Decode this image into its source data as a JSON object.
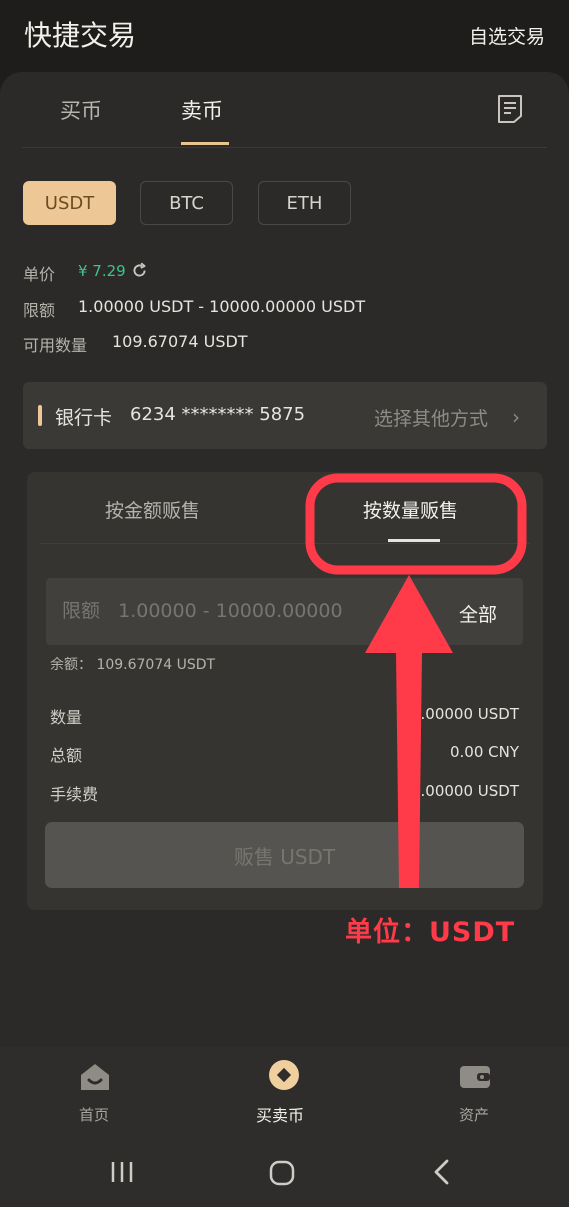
{
  "header": {
    "title": "快捷交易",
    "custom_trade": "自选交易"
  },
  "trade_tabs": {
    "buy": "买币",
    "sell": "卖币"
  },
  "coins": [
    "USDT",
    "BTC",
    "ETH"
  ],
  "info": {
    "price_label": "单价",
    "price_value": "¥ 7.29",
    "limit_label": "限额",
    "limit_value": "1.00000 USDT - 10000.00000 USDT",
    "available_label": "可用数量",
    "available_value": "109.67074 USDT"
  },
  "payment": {
    "label": "银行卡",
    "number": "6234 ******** 5875",
    "other": "选择其他方式"
  },
  "sell_tabs": {
    "by_amount": "按金额贩售",
    "by_quantity": "按数量贩售"
  },
  "form": {
    "placeholder": "限额   1.00000 - 10000.00000",
    "all": "全部",
    "balance": "余额：  109.67074 USDT",
    "quantity_label": "数量",
    "quantity_value": ".00000 USDT",
    "total_label": "总额",
    "total_value": "0.00 CNY",
    "fee_label": "手续费",
    "fee_value": ".00000 USDT",
    "submit": "贩售 USDT"
  },
  "annotation": {
    "text": "单位：USDT",
    "color": "#ff3b4a"
  },
  "bottom_nav": [
    {
      "label": "首页",
      "icon": "home-icon"
    },
    {
      "label": "买卖币",
      "icon": "trade-icon"
    },
    {
      "label": "资产",
      "icon": "wallet-icon"
    }
  ],
  "colors": {
    "accent": "#eec796",
    "price_green": "#3fc38b"
  }
}
